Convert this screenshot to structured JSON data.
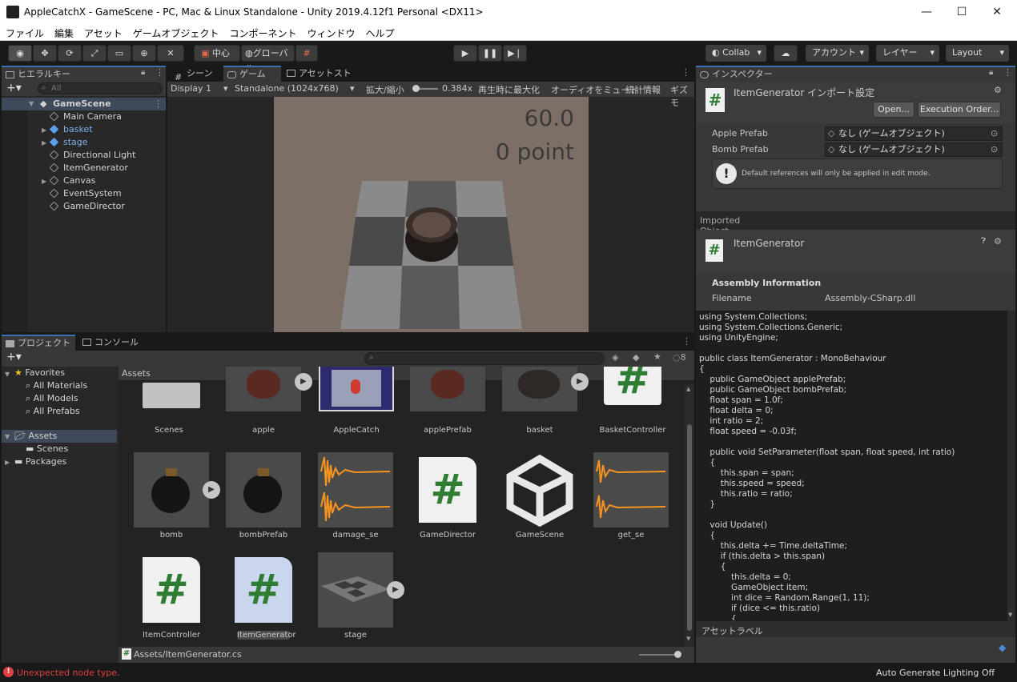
{
  "window": {
    "title": "AppleCatchX - GameScene - PC, Mac & Linux Standalone - Unity 2019.4.12f1 Personal <DX11>",
    "controls": {
      "minimize": "—",
      "maximize": "☐",
      "close": "✕"
    }
  },
  "menu": [
    "ファイル",
    "編集",
    "アセット",
    "ゲームオブジェクト",
    "コンポーネント",
    "ウィンドウ",
    "ヘルプ"
  ],
  "toolbar": {
    "pivot": "中心",
    "space": "グローバル",
    "collab": "Collab",
    "account": "アカウント",
    "layers": "レイヤー",
    "layout": "Layout"
  },
  "hierarchy": {
    "tab": "ヒエラルキー",
    "search_placeholder": "All",
    "scene": "GameScene",
    "items": [
      {
        "label": "Main Camera",
        "prefab": false,
        "expandable": false
      },
      {
        "label": "basket",
        "prefab": true,
        "expandable": true
      },
      {
        "label": "stage",
        "prefab": true,
        "expandable": true
      },
      {
        "label": "Directional Light",
        "prefab": false,
        "expandable": false
      },
      {
        "label": "ItemGenerator",
        "prefab": false,
        "expandable": false
      },
      {
        "label": "Canvas",
        "prefab": false,
        "expandable": true
      },
      {
        "label": "EventSystem",
        "prefab": false,
        "expandable": false
      },
      {
        "label": "GameDirector",
        "prefab": false,
        "expandable": false
      }
    ]
  },
  "scene_tabs": {
    "scene": "シーン",
    "game": "ゲーム",
    "asset_store": "アセットストア"
  },
  "game_view": {
    "display": "Display 1",
    "resolution": "Standalone (1024x768)",
    "scale_label": "拡大/縮小",
    "scale_value": "0.384x",
    "maximize_on_play": "再生時に最大化",
    "mute_audio": "オーディオをミュート",
    "stats": "統計情報",
    "gizmos": "ギズモ",
    "timer": "60.0",
    "score": "0 point"
  },
  "project": {
    "tab_project": "プロジェクト",
    "tab_console": "コンソール",
    "hidden_count": "8",
    "favorites": "Favorites",
    "fav_items": [
      "All Materials",
      "All Models",
      "All Prefabs"
    ],
    "assets_root": "Assets",
    "assets_children": [
      "Scenes"
    ],
    "packages": "Packages",
    "breadcrumb": "Assets",
    "assets": [
      {
        "name": "Scenes",
        "kind": "folder"
      },
      {
        "name": "apple",
        "kind": "model-red"
      },
      {
        "name": "AppleCatch",
        "kind": "image"
      },
      {
        "name": "applePrefab",
        "kind": "model-red"
      },
      {
        "name": "basket",
        "kind": "model-dark"
      },
      {
        "name": "BasketController",
        "kind": "script"
      },
      {
        "name": "bomb",
        "kind": "bomb"
      },
      {
        "name": "bombPrefab",
        "kind": "bomb"
      },
      {
        "name": "damage_se",
        "kind": "audio"
      },
      {
        "name": "GameDirector",
        "kind": "script"
      },
      {
        "name": "GameScene",
        "kind": "unity"
      },
      {
        "name": "get_se",
        "kind": "audio"
      },
      {
        "name": "ItemController",
        "kind": "script"
      },
      {
        "name": "ItemGenerator",
        "kind": "script"
      },
      {
        "name": "stage",
        "kind": "stage"
      }
    ],
    "footer_path": "Assets/ItemGenerator.cs"
  },
  "inspector": {
    "tab": "インスペクター",
    "title": "ItemGenerator インポート設定",
    "open_btn": "Open...",
    "exec_order_btn": "Execution Order...",
    "fields": [
      {
        "label": "Apple Prefab",
        "value": "なし (ゲームオブジェクト)"
      },
      {
        "label": "Bomb Prefab",
        "value": "なし (ゲームオブジェクト)"
      }
    ],
    "info": "Default references will only be applied in edit mode.",
    "imported_object": "Imported Object",
    "object_name": "ItemGenerator",
    "assembly_info": "Assembly Information",
    "filename_label": "Filename",
    "filename_value": "Assembly-CSharp.dll",
    "code": "using System.Collections;\nusing System.Collections.Generic;\nusing UnityEngine;\n\npublic class ItemGenerator : MonoBehaviour\n{\n    public GameObject applePrefab;\n    public GameObject bombPrefab;\n    float span = 1.0f;\n    float delta = 0;\n    int ratio = 2;\n    float speed = -0.03f;\n\n    public void SetParameter(float span, float speed, int ratio)\n    {\n        this.span = span;\n        this.speed = speed;\n        this.ratio = ratio;\n    }\n\n    void Update()\n    {\n        this.delta += Time.deltaTime;\n        if (this.delta > this.span)\n        {\n            this.delta = 0;\n            GameObject item;\n            int dice = Random.Range(1, 11);\n            if (dice <= this.ratio)\n            {",
    "asset_labels": "アセットラベル"
  },
  "status": {
    "error": "Unexpected node type.",
    "lighting": "Auto Generate Lighting Off"
  },
  "colors": {
    "accent": "#3a72b0",
    "error": "#e04040",
    "script_green": "#2e7d32",
    "audio_orange": "#f7931e"
  }
}
